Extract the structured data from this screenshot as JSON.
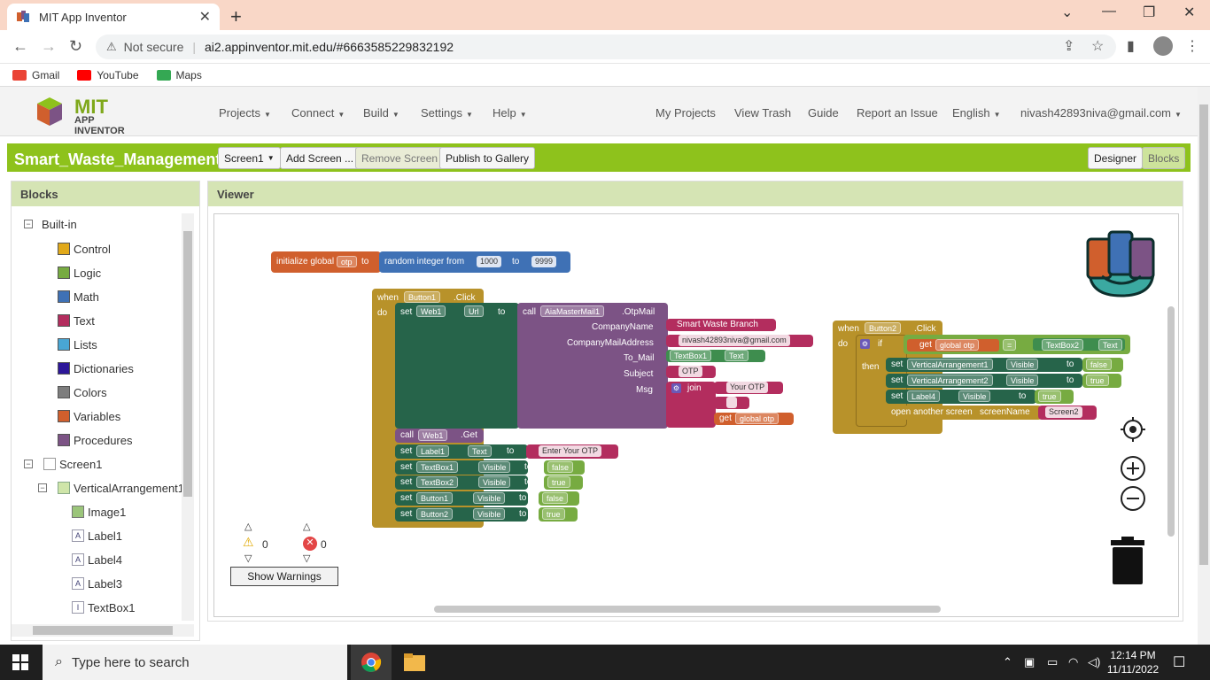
{
  "browser": {
    "tab_title": "MIT App Inventor",
    "not_secure": "Not secure",
    "url": "ai2.appinventor.mit.edu/#6663585229832192",
    "bookmarks": [
      {
        "label": "Gmail",
        "color": "#ea4335"
      },
      {
        "label": "YouTube",
        "color": "#ff0000"
      },
      {
        "label": "Maps",
        "color": "#34a853"
      }
    ]
  },
  "app": {
    "logo_mit": "MIT",
    "logo_sub": "APP INVENTOR",
    "menus": [
      "Projects",
      "Connect",
      "Build",
      "Settings",
      "Help"
    ],
    "right_links": [
      "My Projects",
      "View Trash",
      "Guide",
      "Report an Issue",
      "English",
      "nivash42893niva@gmail.com"
    ]
  },
  "project": {
    "name": "Smart_Waste_Management",
    "screen_select": "Screen1",
    "add_screen": "Add Screen ...",
    "remove_screen": "Remove Screen",
    "publish": "Publish to Gallery",
    "designer": "Designer",
    "blocks": "Blocks"
  },
  "blocks_panel": {
    "title": "Blocks",
    "builtin": "Built-in",
    "categories": [
      {
        "label": "Control",
        "color": "#e1a91a"
      },
      {
        "label": "Logic",
        "color": "#77ab41"
      },
      {
        "label": "Math",
        "color": "#3f71b5"
      },
      {
        "label": "Text",
        "color": "#b32d5e"
      },
      {
        "label": "Lists",
        "color": "#49a6d4"
      },
      {
        "label": "Dictionaries",
        "color": "#2d1799"
      },
      {
        "label": "Colors",
        "color": "#7d7d7d"
      },
      {
        "label": "Variables",
        "color": "#d05f2d"
      },
      {
        "label": "Procedures",
        "color": "#7c5385"
      }
    ],
    "screen": "Screen1",
    "arrangement": "VerticalArrangement1",
    "components": [
      "Image1",
      "Label1",
      "Label4",
      "Label3",
      "TextBox1"
    ]
  },
  "viewer": {
    "title": "Viewer",
    "show_warnings": "Show Warnings",
    "warning_count": "0",
    "error_count": "0"
  },
  "blocks": {
    "init_global": "initialize global",
    "otp_var": "otp",
    "to": "to",
    "random_int": "random integer from",
    "rand_from": "1000",
    "rand_to": "9999",
    "when": "when",
    "do": "do",
    "btn1": "Button1",
    "click": ".Click",
    "set": "set",
    "web1": "Web1",
    "url": "Url",
    "call": "call",
    "mailer": "AiaMasterMail1",
    "otpmail": ".OtpMail",
    "company_name_lbl": "CompanyName",
    "company_name_val": "Smart Waste Branch",
    "company_mail_lbl": "CompanyMailAddress",
    "company_mail_val": "nivash42893niva@gmail.com",
    "to_mail_lbl": "To_Mail",
    "textbox1": "TextBox1",
    "text_prop": "Text",
    "subject_lbl": "Subject",
    "subject_val": "OTP",
    "msg_lbl": "Msg",
    "join": "join",
    "msg_val": "Your OTP",
    "empty_str": "",
    "get": "get",
    "global_otp": "global otp",
    "web_get": ".Get",
    "label1": "Label1",
    "enter_otp": "Enter Your OTP",
    "textbox2": "TextBox2",
    "visible": "Visible",
    "false": "false",
    "true": "true",
    "button1": "Button1",
    "button2": "Button2",
    "btn2": "Button2",
    "if": "if",
    "then": "then",
    "eq": "=",
    "va1": "VerticalArrangement1",
    "va2": "VerticalArrangement2",
    "label4": "Label4",
    "open_screen": "open another screen",
    "screen_name": "screenName",
    "screen2": "Screen2"
  },
  "taskbar": {
    "search_placeholder": "Type here to search",
    "time": "12:14 PM",
    "date": "11/11/2022"
  }
}
